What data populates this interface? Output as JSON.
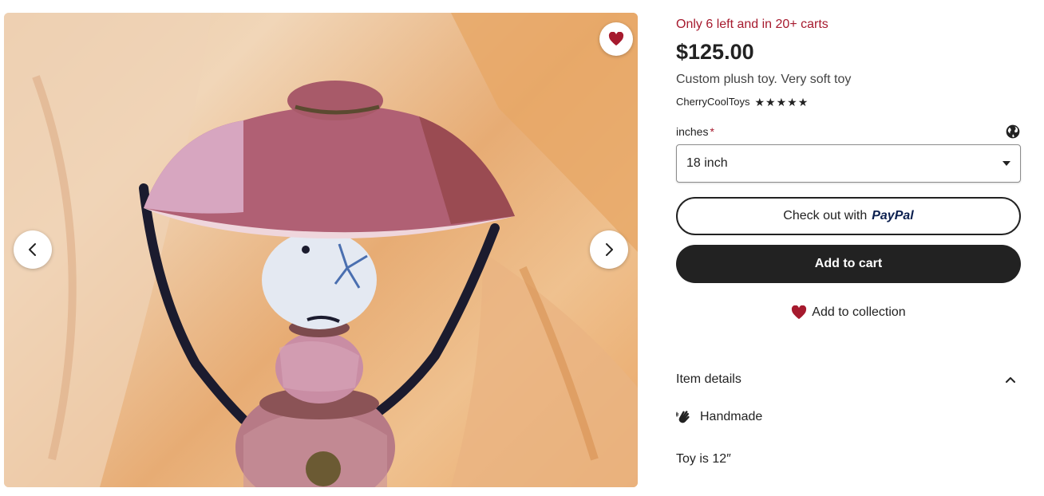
{
  "gallery": {
    "image_alt": "Custom plush toy",
    "icons": {
      "favorite": "heart-icon",
      "prev": "chevron-left-icon",
      "next": "chevron-right-icon"
    }
  },
  "listing": {
    "scarcity": "Only 6 left and in 20+ carts",
    "price": "$125.00",
    "title": "Custom plush toy. Very soft toy",
    "shop_name": "CherryCoolToys",
    "rating": 5,
    "stars": [
      "★",
      "★",
      "★",
      "★",
      "★"
    ]
  },
  "variation": {
    "label": "inches",
    "required_mark": "*",
    "selected": "18 inch",
    "icon": "globe-icon"
  },
  "buttons": {
    "paypal_prefix": "Check out with",
    "paypal_brand": "PayPal",
    "add_to_cart": "Add to cart",
    "add_to_collection": "Add to collection"
  },
  "details": {
    "title": "Item details",
    "handmade": "Handmade",
    "description": "Toy is 12″"
  },
  "colors": {
    "accent_red": "#a61a2e",
    "button_dark": "#222222",
    "heart": "#a61a2e"
  }
}
